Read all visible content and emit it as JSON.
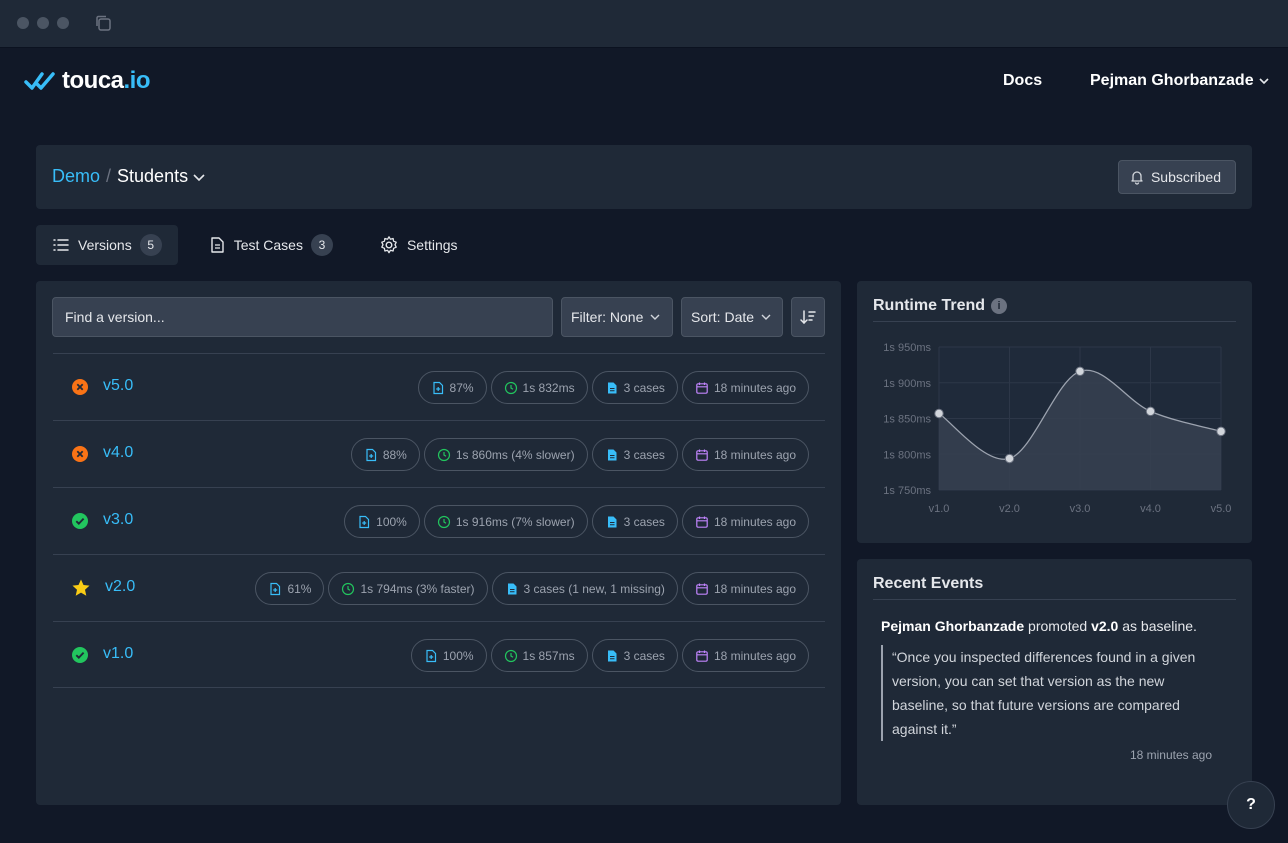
{
  "brand": {
    "name_main": "touca",
    "name_suffix": ".io",
    "accent": "#38bdf8"
  },
  "nav": {
    "docs_label": "Docs",
    "user_name": "Pejman Ghorbanzade"
  },
  "breadcrumb": {
    "team": "Demo",
    "separator": "/",
    "suite": "Students"
  },
  "subscribe": {
    "label": "Subscribed"
  },
  "tabs": [
    {
      "label": "Versions",
      "count": "5",
      "icon": "list-icon"
    },
    {
      "label": "Test Cases",
      "count": "3",
      "icon": "document-icon"
    },
    {
      "label": "Settings",
      "count": "",
      "icon": "gear-icon"
    }
  ],
  "toolbar": {
    "search_placeholder": "Find a version...",
    "filter_label": "Filter: None",
    "sort_label": "Sort: Date"
  },
  "versions": [
    {
      "name": "v5.0",
      "status": "failed",
      "match": "87%",
      "duration": "1s 832ms",
      "cases": "3 cases",
      "time": "18 minutes ago"
    },
    {
      "name": "v4.0",
      "status": "failed",
      "match": "88%",
      "duration": "1s 860ms (4% slower)",
      "cases": "3 cases",
      "time": "18 minutes ago"
    },
    {
      "name": "v3.0",
      "status": "passed",
      "match": "100%",
      "duration": "1s 916ms (7% slower)",
      "cases": "3 cases",
      "time": "18 minutes ago"
    },
    {
      "name": "v2.0",
      "status": "baseline",
      "match": "61%",
      "duration": "1s 794ms (3% faster)",
      "cases": "3 cases (1 new, 1 missing)",
      "time": "18 minutes ago"
    },
    {
      "name": "v1.0",
      "status": "passed",
      "match": "100%",
      "duration": "1s 857ms",
      "cases": "3 cases",
      "time": "18 minutes ago"
    }
  ],
  "trend": {
    "title": "Runtime Trend",
    "info_glyph": "i",
    "chart_data": {
      "type": "area",
      "categories": [
        "v1.0",
        "v2.0",
        "v3.0",
        "v4.0",
        "v5.0"
      ],
      "values": [
        1857,
        1794,
        1916,
        1860,
        1832
      ],
      "yticks": [
        1950,
        1900,
        1850,
        1800,
        1750
      ],
      "ytick_labels": [
        "1s 950ms",
        "1s 900ms",
        "1s 850ms",
        "1s 800ms",
        "1s 750ms"
      ],
      "ylim": [
        1750,
        1950
      ],
      "grid": true,
      "line_color": "#9ca3af",
      "fill_color": "#374151"
    }
  },
  "events": {
    "title": "Recent Events",
    "actor": "Pejman Ghorbanzade",
    "action": "promoted",
    "version": "v2.0",
    "action_suffix": "as baseline.",
    "quote": "“Once you inspected differences found in a given version, you can set that version as the new baseline, so that future versions are compared against it.”",
    "time": "18 minutes ago"
  },
  "help": {
    "label": "?"
  },
  "colors": {
    "failed": "#f97316",
    "passed": "#22c55e",
    "baseline": "#facc15",
    "match_icon": "#38bdf8",
    "time_icon": "#22c55e",
    "cases_icon": "#38bdf8",
    "date_icon": "#c084fc"
  }
}
